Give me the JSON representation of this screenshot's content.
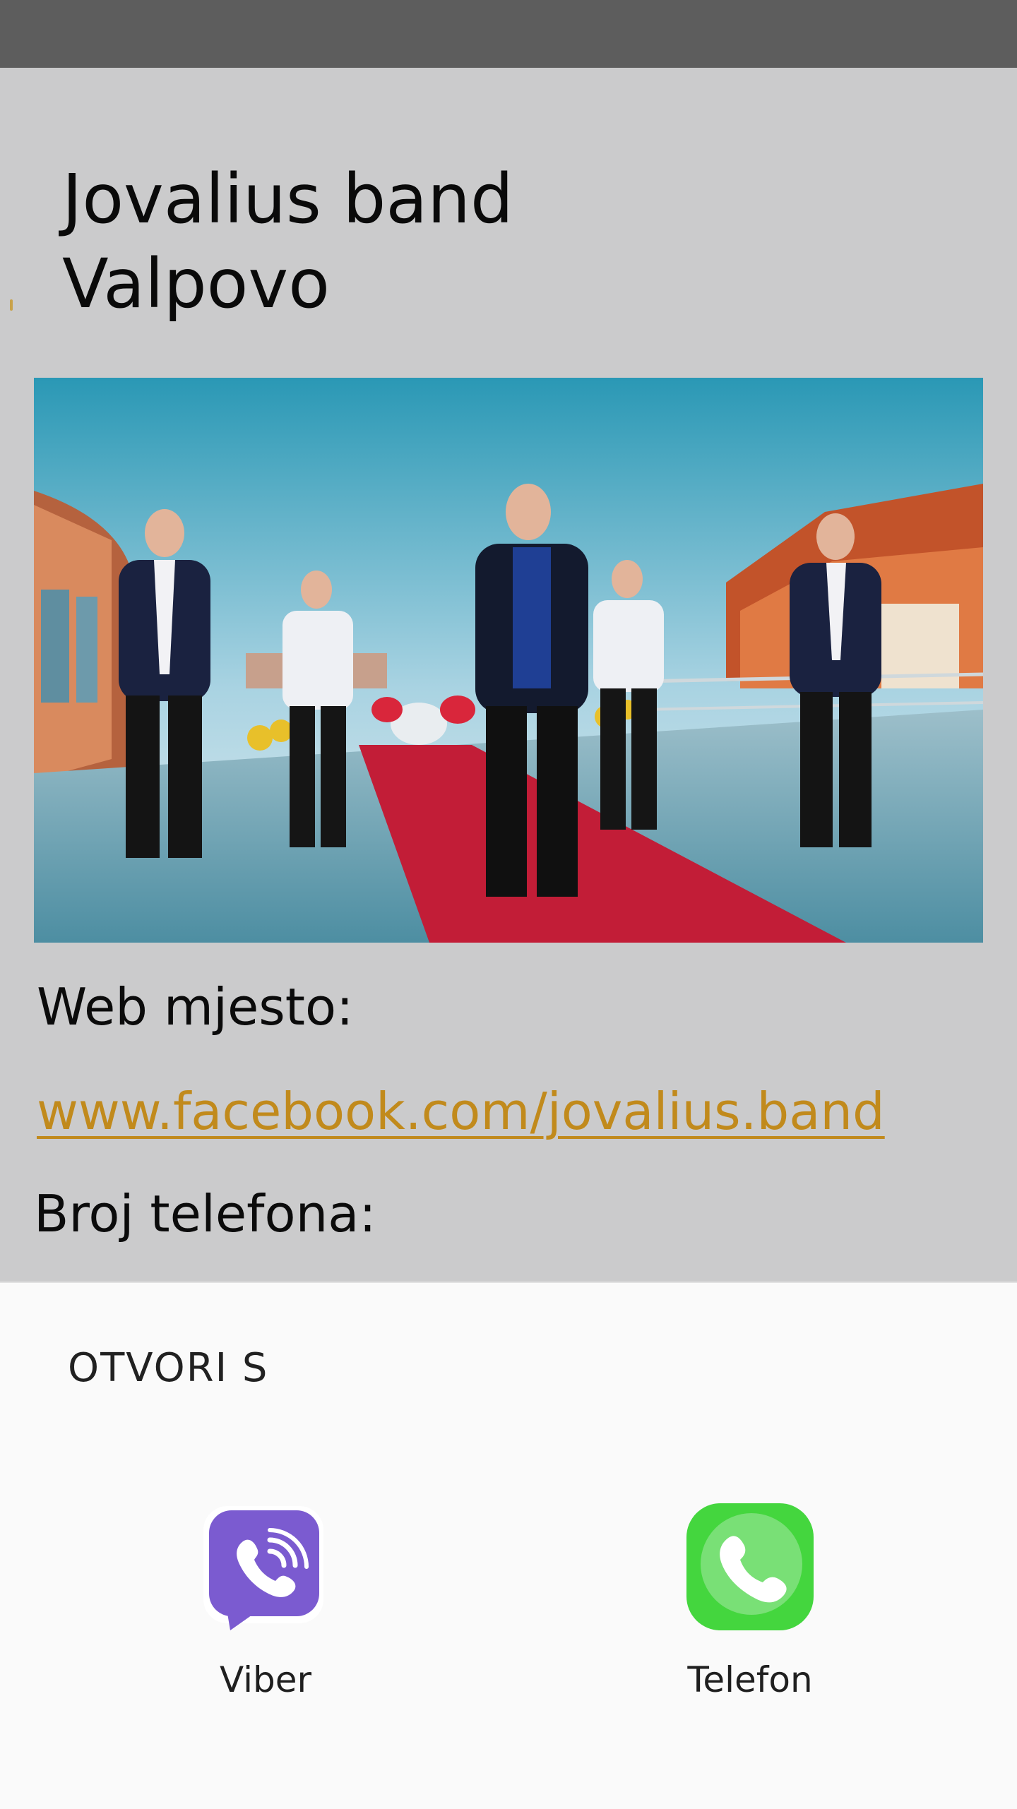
{
  "header": {
    "title": "Jovalius band\nValpovo"
  },
  "photo": {
    "alt": "Jovalius band"
  },
  "details": {
    "website_label": "Web mjesto:",
    "website_url": "www.facebook.com/jovalius.band",
    "phone_label": "Broj telefona:"
  },
  "open_with_sheet": {
    "title": "OTVORI S",
    "apps": [
      {
        "label": "Viber",
        "icon": "viber-icon",
        "color": "#7b5bd0"
      },
      {
        "label": "Telefon",
        "icon": "phone-icon",
        "color": "#44d63e"
      }
    ]
  },
  "colors": {
    "status_bar": "#5d5d5d",
    "page_background": "#cbcbcc",
    "link": "#c18a1c",
    "sheet_background": "#fafafa"
  }
}
